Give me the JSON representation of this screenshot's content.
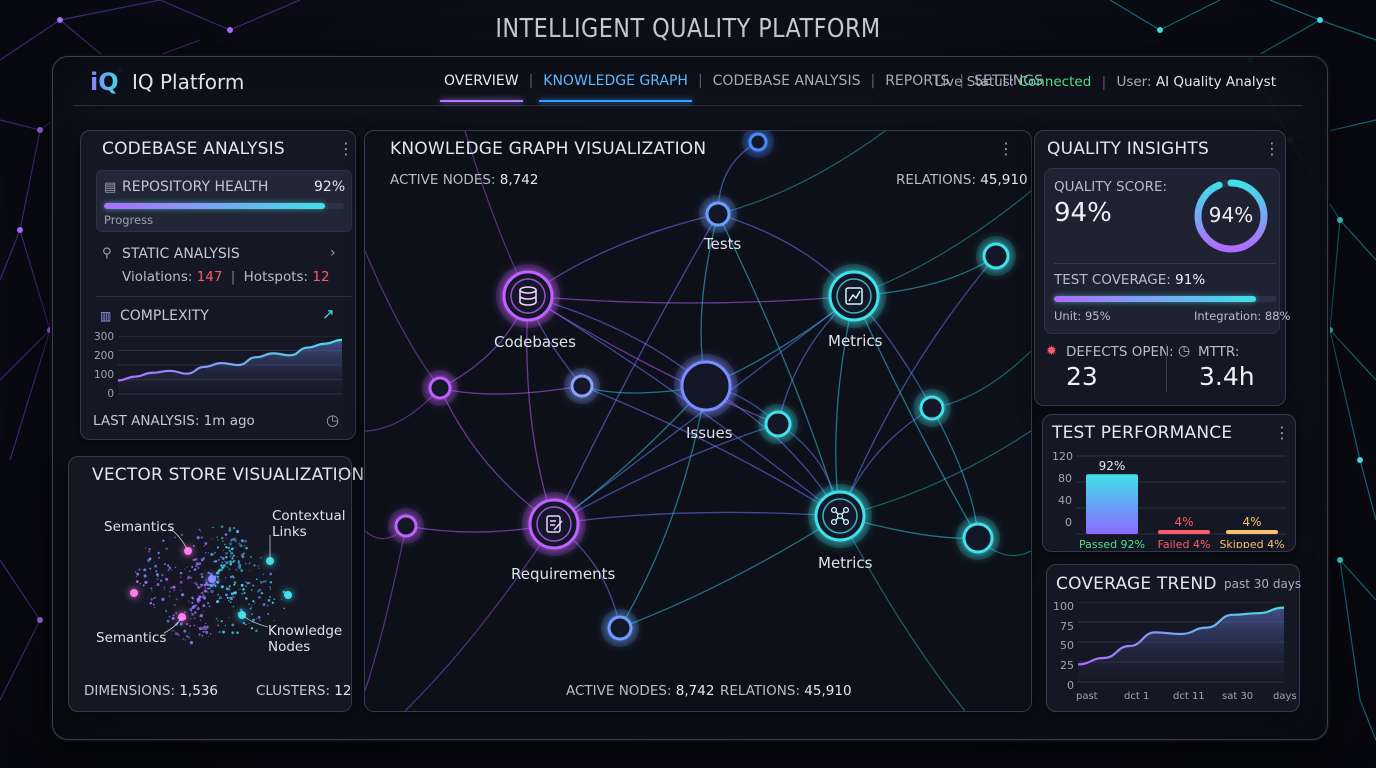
{
  "page_title": "INTELLIGENT QUALITY PLATFORM",
  "header": {
    "logo": "iQ",
    "brand": "IQ Platform",
    "nav": [
      "OVERVIEW",
      "KNOWLEDGE GRAPH",
      "CODEBASE ANALYSIS",
      "REPORTS",
      "SETTINGS"
    ],
    "status_label": "Live Status:",
    "status_value": "Connected",
    "user_label": "User:",
    "user_value": "AI Quality Analyst"
  },
  "codebase": {
    "title": "CODEBASE ANALYSIS",
    "repo_health_label": "REPOSITORY HEALTH",
    "repo_health_value": "92%",
    "repo_health_fraction": 0.92,
    "progress_label": "Progress",
    "static_label": "STATIC ANALYSIS",
    "violations_label": "Violations:",
    "violations_value": "147",
    "hotspots_label": "Hotspots:",
    "hotspots_value": "12",
    "complexity_label": "COMPLEXITY",
    "y_ticks": [
      "300",
      "200",
      "100",
      "0"
    ],
    "last_analysis": "LAST ANALYSIS: 1m ago"
  },
  "vector": {
    "title": "VECTOR STORE VISUALIZATION",
    "labels": [
      "Semantics",
      "Contextual Links",
      "Semantics",
      "Knowledge Nodes"
    ],
    "dimensions_label": "DIMENSIONS:",
    "dimensions_value": "1,536",
    "clusters_label": "CLUSTERS:",
    "clusters_value": "12"
  },
  "graph": {
    "title": "KNOWLEDGE GRAPH VISUALIZATION",
    "active_label": "ACTIVE NODES:",
    "active_value": "8,742",
    "relations_label": "RELATIONS:",
    "relations_value": "45,910",
    "nodes": [
      "Tests",
      "Codebases",
      "Metrics",
      "Issues",
      "Requirements",
      "Metrics"
    ]
  },
  "insights": {
    "title": "QUALITY INSIGHTS",
    "score_label": "QUALITY SCORE:",
    "score_value": "94%",
    "score_fraction": 0.94,
    "coverage_label": "TEST COVERAGE:",
    "coverage_value": "91%",
    "coverage_fraction": 0.91,
    "unit_label": "Unit:",
    "unit_value": "95%",
    "integration_label": "Integration:",
    "integration_value": "88%",
    "defects_label": "DEFECTS OPEN:",
    "defects_value": "23",
    "mttr_label": "MTTR:",
    "mttr_value": "3.4h"
  },
  "test_perf": {
    "title": "TEST PERFORMANCE",
    "y_ticks": [
      "120",
      "80",
      "40",
      "0"
    ],
    "bars": [
      {
        "label": "Passed 92%",
        "value": 92,
        "top_label": "92%",
        "color": "#3fe0e8"
      },
      {
        "label": "Failed 4%",
        "value": 4,
        "top_label": "4%",
        "color": "#ff5a6a"
      },
      {
        "label": "Skipped 4%",
        "value": 4,
        "top_label": "4%",
        "color": "#f5c26b"
      }
    ]
  },
  "coverage_trend": {
    "title": "COVERAGE TREND",
    "subtitle": "past 30 days",
    "y_ticks": [
      "100",
      "75",
      "50",
      "25",
      "0"
    ],
    "x_ticks": [
      "past",
      "dct 1",
      "dct 11",
      "sat 30",
      "days"
    ]
  },
  "chart_data": [
    {
      "type": "bar",
      "title": "TEST PERFORMANCE",
      "categories": [
        "Passed 92%",
        "Failed 4%",
        "Skipped 4%"
      ],
      "values": [
        92,
        4,
        4
      ],
      "ylim": [
        0,
        120
      ]
    },
    {
      "type": "area",
      "title": "COVERAGE TREND",
      "x": [
        "past",
        "dct 1",
        "dct 11",
        "sat 30",
        "days"
      ],
      "values": [
        22,
        30,
        45,
        62,
        60,
        68,
        84,
        86,
        93
      ],
      "ylim": [
        0,
        100
      ]
    },
    {
      "type": "area",
      "title": "COMPLEXITY",
      "values": [
        70,
        90,
        110,
        120,
        105,
        140,
        160,
        150,
        190,
        210,
        200,
        240,
        260,
        280
      ],
      "ylim": [
        0,
        300
      ]
    }
  ]
}
